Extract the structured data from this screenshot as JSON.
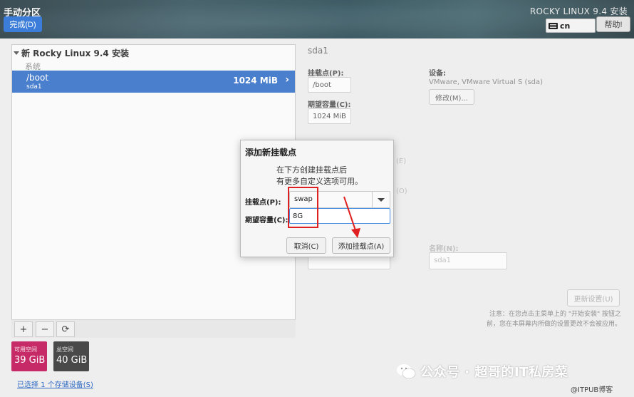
{
  "header": {
    "title": "手动分区",
    "done_label": "完成(D)",
    "product": "ROCKY LINUX 9.4 安装",
    "keyboard_layout": "cn",
    "help_label": "帮助!"
  },
  "left": {
    "install_title": "新 Rocky Linux 9.4 安装",
    "system_label": "系统",
    "selected": {
      "mount": "/boot",
      "device": "sda1",
      "size": "1024 MiB"
    },
    "toolbar": {
      "add": "+",
      "remove": "−",
      "refresh": "⟳"
    },
    "available": {
      "label": "可用空间",
      "value": "39 GiB",
      "color": "#c2185b"
    },
    "total": {
      "label": "总空间",
      "value": "40 GiB",
      "color": "#3a3a3a"
    },
    "storage_link": "已选择 1 个存储设备(S)"
  },
  "right": {
    "title": "sda1",
    "mount_label": "挂载点(P):",
    "mount_value": "/boot",
    "capacity_label": "期望容量(C):",
    "capacity_value": "1024 MiB",
    "device_label": "设备:",
    "device_value": "VMware, VMware Virtual S (sda)",
    "modify_label": "修改(M)...",
    "name_label": "名称(N):",
    "name_value": "sda1",
    "update_label": "更新设置(U)",
    "note": "注意：在您点击主菜单上的 \"开始安装\" 按钮之前，您在本屏幕内所做的设置更改不会被应用。",
    "faint_e": "(E)",
    "faint_o": "(O)"
  },
  "dialog": {
    "title": "添加新挂载点",
    "msg_line1": "在下方创建挂载点后",
    "msg_line2": "有更多自定义选项可用。",
    "mount_label": "挂载点(P):",
    "mount_value": "swap",
    "capacity_label": "期望容量(C):",
    "capacity_value": "8G",
    "cancel_label": "取消(C)",
    "add_label": "添加挂载点(A)"
  },
  "watermark": {
    "text": "公众号 · 超哥的IT私房菜",
    "site": "@ITPUB博客"
  },
  "colors": {
    "accent": "#3b75c9",
    "highlight": "#e02020"
  }
}
